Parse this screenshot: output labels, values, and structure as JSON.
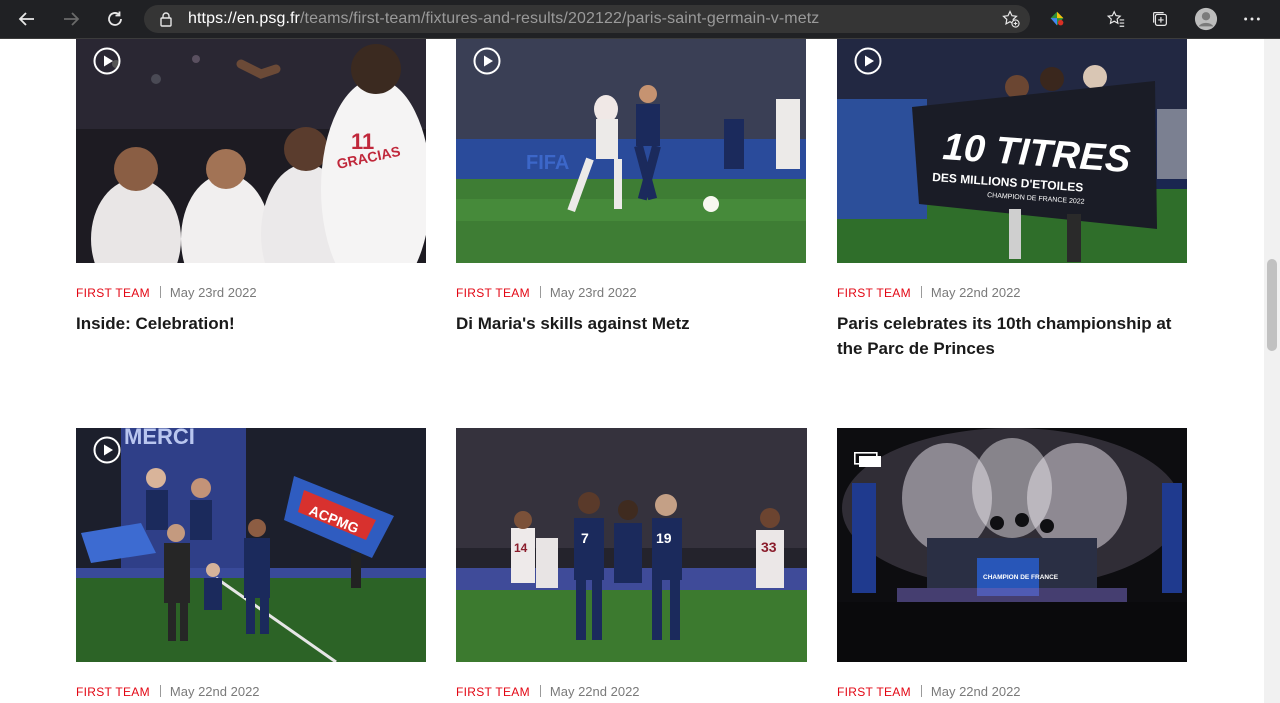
{
  "browser": {
    "url_host": "https://en.psg.fr",
    "url_path": "/teams/first-team/fixtures-and-results/202122/paris-saint-germain-v-metz"
  },
  "cards": [
    {
      "category": "FIRST TEAM",
      "date": "May 23rd 2022",
      "title": "Inside: Celebration!",
      "media": "video"
    },
    {
      "category": "FIRST TEAM",
      "date": "May 23rd 2022",
      "title": "Di Maria's skills against Metz",
      "media": "video"
    },
    {
      "category": "FIRST TEAM",
      "date": "May 22nd 2022",
      "title": "Paris celebrates its 10th championship at the Parc de Princes",
      "media": "video",
      "banner_line1": "10 TITRES",
      "banner_line2": "DES MILLIONS D'ETOILES",
      "banner_line3": "CHAMPION DE FRANCE 2022"
    },
    {
      "category": "FIRST TEAM",
      "date": "May 22nd 2022",
      "title": "",
      "media": "video",
      "banner_text": "MERCI",
      "flag_text": "ACPMG"
    },
    {
      "category": "FIRST TEAM",
      "date": "May 22nd 2022",
      "title": "",
      "media": "photo",
      "shirt_numbers": [
        "7",
        "19",
        "33",
        "14"
      ]
    },
    {
      "category": "FIRST TEAM",
      "date": "May 22nd 2022",
      "title": "",
      "media": "gallery",
      "board_text": "CHAMPION DE FRANCE"
    }
  ],
  "colors": {
    "accent": "#e30613",
    "psg_navy": "#1b2a5c",
    "chrome_bg": "#202124"
  }
}
